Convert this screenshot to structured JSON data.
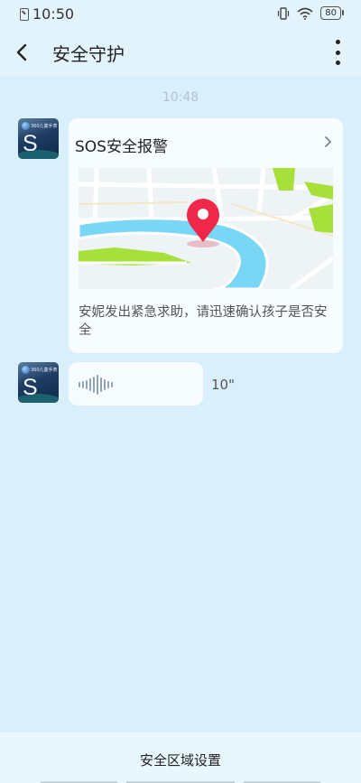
{
  "status_bar": {
    "time": "10:50",
    "battery": "80",
    "icons": [
      "sim-icon",
      "vibrate-icon",
      "wifi-icon",
      "battery-icon"
    ]
  },
  "header": {
    "title": "安全守护",
    "back_icon": "back-arrow-icon",
    "more_icon": "more-vertical-icon"
  },
  "chat": {
    "timestamp": "10:48",
    "avatar_logo": "S 1",
    "avatar_brand": "360儿童手表",
    "sos_card": {
      "title": "SOS安全报警",
      "description": "安妮发出紧急求助，请迅速确认孩子是否安全",
      "chevron_icon": "chevron-right-icon",
      "map_pin_icon": "location-pin-icon"
    },
    "voice_message": {
      "duration": "10\"",
      "icon": "audio-wave-icon"
    }
  },
  "bottom": {
    "button_label": "安全区域设置"
  },
  "colors": {
    "background": "#d9effb",
    "card": "#f6fcff",
    "pin": "#f0284a",
    "river": "#79d6f5",
    "park": "#a7e03a"
  }
}
